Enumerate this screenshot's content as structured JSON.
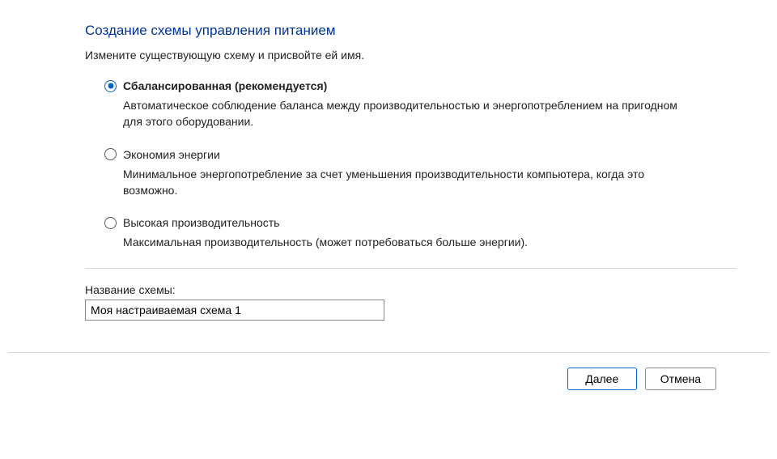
{
  "title": "Создание схемы управления питанием",
  "subtitle": "Измените существующую схему и присвойте ей имя.",
  "options": [
    {
      "label": "Сбалансированная (рекомендуется)",
      "description": "Автоматическое соблюдение баланса между производительностью и энергопотреблением на пригодном для этого оборудовании.",
      "selected": true
    },
    {
      "label": "Экономия энергии",
      "description": "Минимальное энергопотребление за счет уменьшения производительности компьютера, когда это возможно.",
      "selected": false
    },
    {
      "label": "Высокая производительность",
      "description": "Максимальная производительность (может потребоваться больше энергии).",
      "selected": false
    }
  ],
  "plan_name": {
    "label": "Название схемы:",
    "value": "Моя настраиваемая схема 1"
  },
  "buttons": {
    "next": "Далее",
    "cancel": "Отмена"
  }
}
